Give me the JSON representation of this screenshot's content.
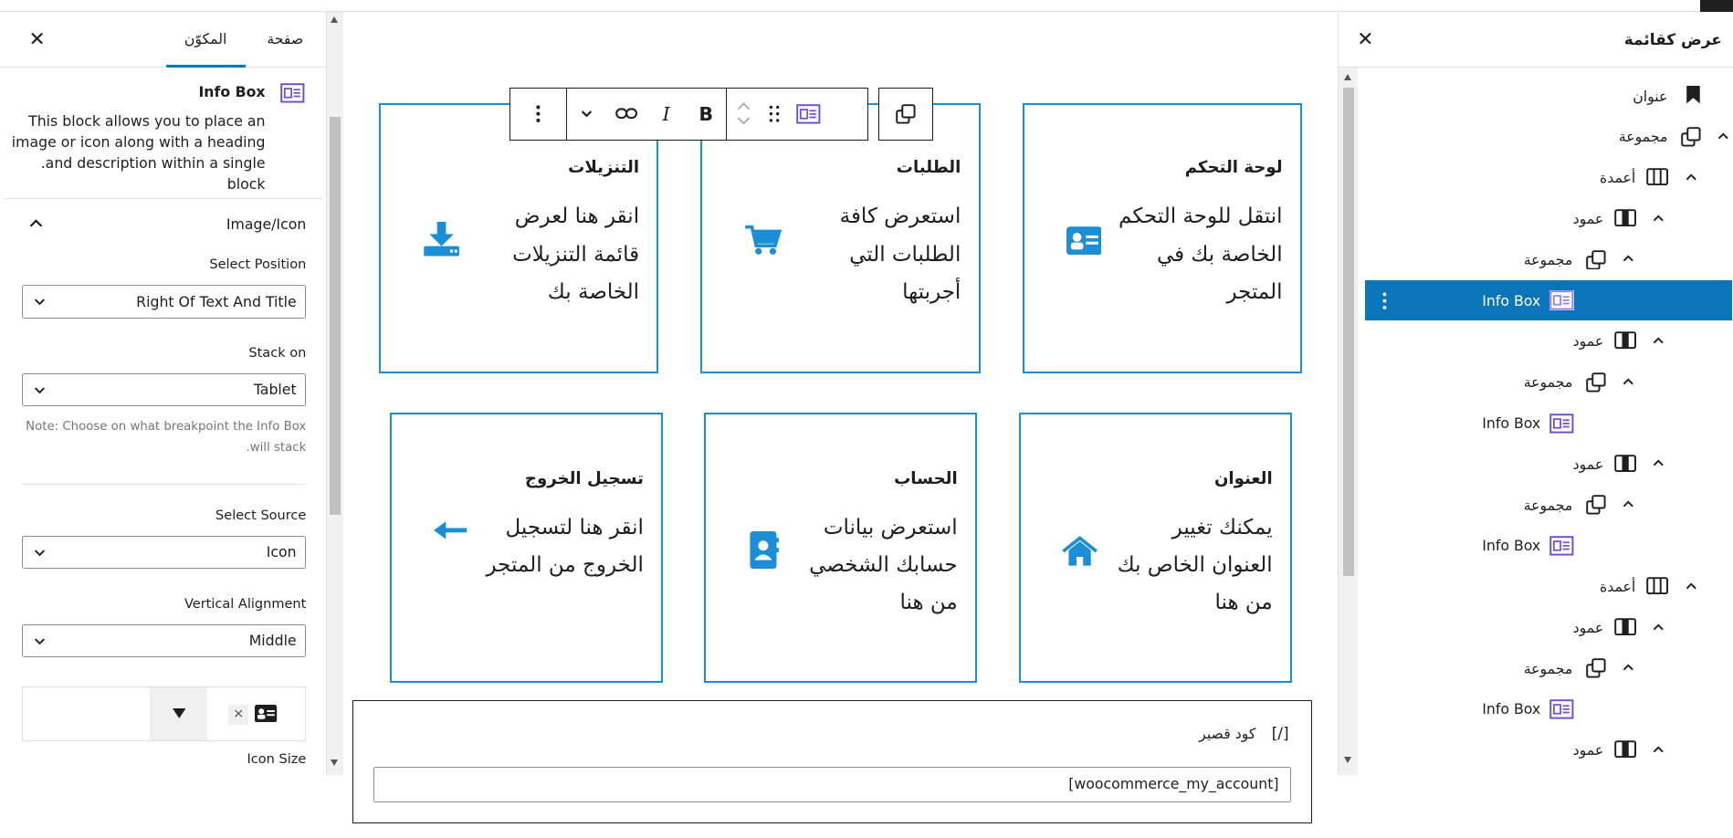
{
  "left_panel": {
    "tabs": [
      "صفحة",
      "المكوّن"
    ],
    "block_name": "Info Box",
    "block_desc_lines": [
      "This block allows you to place an",
      "image or icon along with a heading",
      ".and description within a single block"
    ],
    "section_title": "Image/Icon",
    "fields": {
      "position": {
        "label": "Select Position",
        "value": "Right Of Text And Title"
      },
      "stack": {
        "label": "Stack on",
        "value": "Tablet"
      },
      "stack_note_lines": [
        "Note: Choose on what breakpoint the Info Box",
        ".will stack"
      ],
      "source": {
        "label": "Select Source",
        "value": "Icon"
      },
      "valign": {
        "label": "Vertical Alignment",
        "value": "Middle"
      },
      "icon_size": {
        "label": "Icon Size"
      }
    },
    "icon_picker_clear": "×"
  },
  "toolbar": {
    "bold": "B",
    "italic": "I"
  },
  "cards": [
    {
      "title": "لوحة التحكم",
      "lines": [
        "انتقل للوحة التحكم",
        "الخاصة بك في",
        "المتجر"
      ],
      "icon": "id-card-icon"
    },
    {
      "title": "الطلبات",
      "lines": [
        "استعرض كافة",
        "الطلبات التي",
        "أجربتها"
      ],
      "icon": "cart-icon"
    },
    {
      "title": "التنزيلات",
      "lines": [
        "انقر هنا لعرض",
        "قائمة التنزيلات",
        "الخاصة بك"
      ],
      "icon": "download-icon"
    },
    {
      "title": "العنوان",
      "lines": [
        "يمكنك تغيير",
        "العنوان الخاص بك",
        "من هنا"
      ],
      "icon": "home-icon"
    },
    {
      "title": "الحساب",
      "lines": [
        "استعرض بيانات",
        "حسابك الشخصي",
        "من هنا"
      ],
      "icon": "address-book-icon"
    },
    {
      "title": "تسجيل الخروج",
      "lines": [
        "انقر هنا لتسجيل",
        "الخروج من المتجر"
      ],
      "icon": "arrow-left-icon"
    }
  ],
  "shortcode": {
    "title": "كود قصير",
    "icon_text": "[/]",
    "value": "[woocommerce_my_account]"
  },
  "list_view": {
    "title": "عرض كقائمة",
    "items": [
      "عنوان",
      "مجموعة",
      "أعمدة",
      "عمود",
      "مجموعة",
      "Info Box",
      "عمود",
      "مجموعة",
      "Info Box",
      "عمود",
      "مجموعة",
      "Info Box",
      "أعمدة",
      "عمود",
      "مجموعة",
      "Info Box",
      "عمود"
    ]
  },
  "colors": {
    "accent": "#1c8ed6",
    "selected": "#0a75b8",
    "block_icon": "#6b4fd8"
  }
}
